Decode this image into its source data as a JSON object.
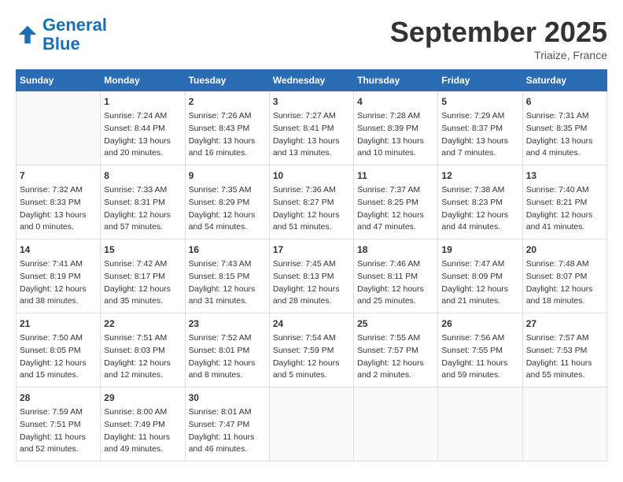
{
  "header": {
    "logo_line1": "General",
    "logo_line2": "Blue",
    "month": "September 2025",
    "location": "Triaize, France"
  },
  "columns": [
    "Sunday",
    "Monday",
    "Tuesday",
    "Wednesday",
    "Thursday",
    "Friday",
    "Saturday"
  ],
  "weeks": [
    [
      {
        "day": "",
        "info": ""
      },
      {
        "day": "1",
        "info": "Sunrise: 7:24 AM\nSunset: 8:44 PM\nDaylight: 13 hours\nand 20 minutes."
      },
      {
        "day": "2",
        "info": "Sunrise: 7:26 AM\nSunset: 8:43 PM\nDaylight: 13 hours\nand 16 minutes."
      },
      {
        "day": "3",
        "info": "Sunrise: 7:27 AM\nSunset: 8:41 PM\nDaylight: 13 hours\nand 13 minutes."
      },
      {
        "day": "4",
        "info": "Sunrise: 7:28 AM\nSunset: 8:39 PM\nDaylight: 13 hours\nand 10 minutes."
      },
      {
        "day": "5",
        "info": "Sunrise: 7:29 AM\nSunset: 8:37 PM\nDaylight: 13 hours\nand 7 minutes."
      },
      {
        "day": "6",
        "info": "Sunrise: 7:31 AM\nSunset: 8:35 PM\nDaylight: 13 hours\nand 4 minutes."
      }
    ],
    [
      {
        "day": "7",
        "info": "Sunrise: 7:32 AM\nSunset: 8:33 PM\nDaylight: 13 hours\nand 0 minutes."
      },
      {
        "day": "8",
        "info": "Sunrise: 7:33 AM\nSunset: 8:31 PM\nDaylight: 12 hours\nand 57 minutes."
      },
      {
        "day": "9",
        "info": "Sunrise: 7:35 AM\nSunset: 8:29 PM\nDaylight: 12 hours\nand 54 minutes."
      },
      {
        "day": "10",
        "info": "Sunrise: 7:36 AM\nSunset: 8:27 PM\nDaylight: 12 hours\nand 51 minutes."
      },
      {
        "day": "11",
        "info": "Sunrise: 7:37 AM\nSunset: 8:25 PM\nDaylight: 12 hours\nand 47 minutes."
      },
      {
        "day": "12",
        "info": "Sunrise: 7:38 AM\nSunset: 8:23 PM\nDaylight: 12 hours\nand 44 minutes."
      },
      {
        "day": "13",
        "info": "Sunrise: 7:40 AM\nSunset: 8:21 PM\nDaylight: 12 hours\nand 41 minutes."
      }
    ],
    [
      {
        "day": "14",
        "info": "Sunrise: 7:41 AM\nSunset: 8:19 PM\nDaylight: 12 hours\nand 38 minutes."
      },
      {
        "day": "15",
        "info": "Sunrise: 7:42 AM\nSunset: 8:17 PM\nDaylight: 12 hours\nand 35 minutes."
      },
      {
        "day": "16",
        "info": "Sunrise: 7:43 AM\nSunset: 8:15 PM\nDaylight: 12 hours\nand 31 minutes."
      },
      {
        "day": "17",
        "info": "Sunrise: 7:45 AM\nSunset: 8:13 PM\nDaylight: 12 hours\nand 28 minutes."
      },
      {
        "day": "18",
        "info": "Sunrise: 7:46 AM\nSunset: 8:11 PM\nDaylight: 12 hours\nand 25 minutes."
      },
      {
        "day": "19",
        "info": "Sunrise: 7:47 AM\nSunset: 8:09 PM\nDaylight: 12 hours\nand 21 minutes."
      },
      {
        "day": "20",
        "info": "Sunrise: 7:48 AM\nSunset: 8:07 PM\nDaylight: 12 hours\nand 18 minutes."
      }
    ],
    [
      {
        "day": "21",
        "info": "Sunrise: 7:50 AM\nSunset: 8:05 PM\nDaylight: 12 hours\nand 15 minutes."
      },
      {
        "day": "22",
        "info": "Sunrise: 7:51 AM\nSunset: 8:03 PM\nDaylight: 12 hours\nand 12 minutes."
      },
      {
        "day": "23",
        "info": "Sunrise: 7:52 AM\nSunset: 8:01 PM\nDaylight: 12 hours\nand 8 minutes."
      },
      {
        "day": "24",
        "info": "Sunrise: 7:54 AM\nSunset: 7:59 PM\nDaylight: 12 hours\nand 5 minutes."
      },
      {
        "day": "25",
        "info": "Sunrise: 7:55 AM\nSunset: 7:57 PM\nDaylight: 12 hours\nand 2 minutes."
      },
      {
        "day": "26",
        "info": "Sunrise: 7:56 AM\nSunset: 7:55 PM\nDaylight: 11 hours\nand 59 minutes."
      },
      {
        "day": "27",
        "info": "Sunrise: 7:57 AM\nSunset: 7:53 PM\nDaylight: 11 hours\nand 55 minutes."
      }
    ],
    [
      {
        "day": "28",
        "info": "Sunrise: 7:59 AM\nSunset: 7:51 PM\nDaylight: 11 hours\nand 52 minutes."
      },
      {
        "day": "29",
        "info": "Sunrise: 8:00 AM\nSunset: 7:49 PM\nDaylight: 11 hours\nand 49 minutes."
      },
      {
        "day": "30",
        "info": "Sunrise: 8:01 AM\nSunset: 7:47 PM\nDaylight: 11 hours\nand 46 minutes."
      },
      {
        "day": "",
        "info": ""
      },
      {
        "day": "",
        "info": ""
      },
      {
        "day": "",
        "info": ""
      },
      {
        "day": "",
        "info": ""
      }
    ]
  ]
}
